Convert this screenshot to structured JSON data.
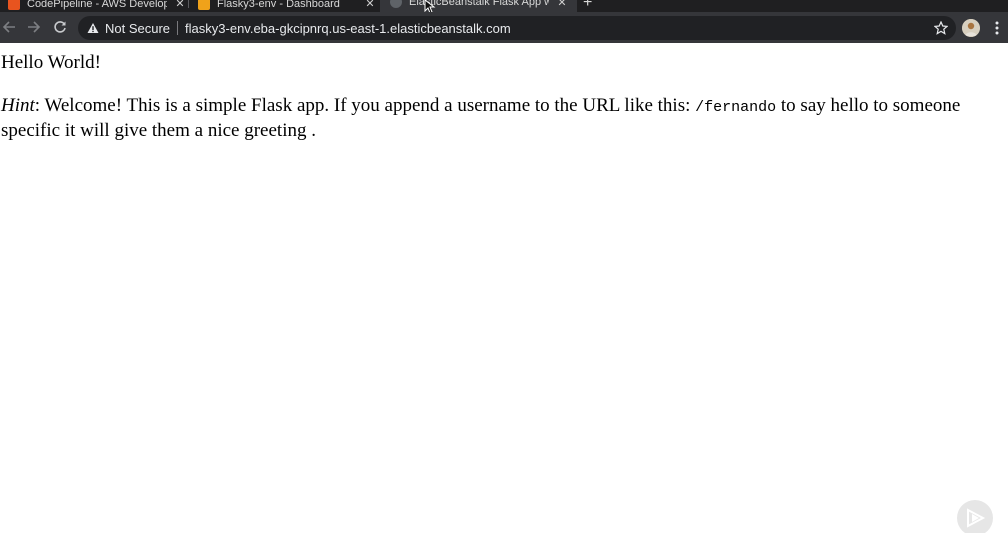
{
  "browser": {
    "tabs": [
      {
        "title": "CodePipeline - AWS Developer",
        "favicon_color": "#e8541f",
        "active": false
      },
      {
        "title": "Flasky3-env - Dashboard",
        "favicon_color": "#f0a21a",
        "active": false
      },
      {
        "title": "ElasticBeanstalk Flask App with",
        "favicon_color": "#5f6368",
        "active": true
      }
    ],
    "tab_close_glyph": "✕",
    "new_tab_glyph": "+",
    "security_label": "Not Secure",
    "url": "flasky3-env.eba-gkcipnrq.us-east-1.elasticbeanstalk.com",
    "colors": {
      "chrome_dark": "#1f1f21",
      "toolbar": "#35363a",
      "omnibox": "#202124"
    }
  },
  "page": {
    "heading": "Hello World!",
    "hint": {
      "label": "Hint",
      "text_before": ": Welcome! This is a simple Flask app. If you append a username to the URL like this: ",
      "code": "/fernando",
      "text_after": " to say hello to someone specific it will give them a nice greeting ."
    }
  },
  "icons": [
    "back-arrow-icon",
    "forward-arrow-icon",
    "reload-icon",
    "warning-icon",
    "star-icon",
    "profile-avatar",
    "kebab-menu-icon",
    "play-icon"
  ]
}
